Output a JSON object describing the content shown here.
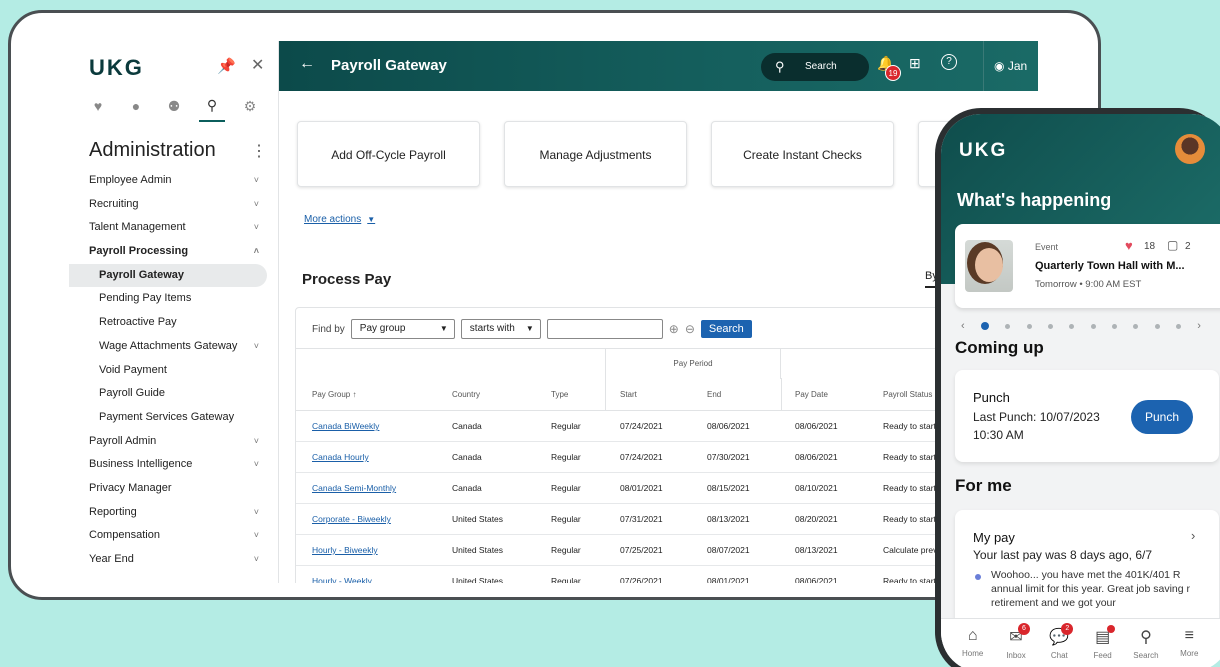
{
  "sidebar": {
    "logo": "UKG",
    "title": "Administration",
    "items": [
      {
        "label": "Employee Admin",
        "chevron": "˅"
      },
      {
        "label": "Recruiting",
        "chevron": "˅"
      },
      {
        "label": "Talent Management",
        "chevron": "˅"
      },
      {
        "label": "Payroll Processing",
        "chevron": "˄"
      },
      {
        "label": "Payroll Gateway"
      },
      {
        "label": "Pending Pay Items"
      },
      {
        "label": "Retroactive Pay"
      },
      {
        "label": "Wage Attachments Gateway",
        "chevron": "˅"
      },
      {
        "label": "Void Payment"
      },
      {
        "label": "Payroll Guide"
      },
      {
        "label": "Payment Services Gateway"
      },
      {
        "label": "Payroll Admin",
        "chevron": "˅"
      },
      {
        "label": "Business Intelligence",
        "chevron": "˅"
      },
      {
        "label": "Privacy Manager"
      },
      {
        "label": "Reporting",
        "chevron": "˅"
      },
      {
        "label": "Compensation",
        "chevron": "˅"
      },
      {
        "label": "Year End",
        "chevron": "˅"
      }
    ],
    "icons": [
      "heart-icon",
      "person-icon",
      "people-icon",
      "admin-icon",
      "gear-icon"
    ]
  },
  "topbar": {
    "title": "Payroll Gateway",
    "search_label": "Search",
    "notifications": "19",
    "user": "Jan"
  },
  "actions": [
    "Add Off-Cycle Payroll",
    "Manage Adjustments",
    "Create Instant Checks"
  ],
  "more_actions": "More actions",
  "process_pay": {
    "title": "Process Pay",
    "view_tab": "By",
    "find_by": "Find by",
    "field": "Pay group",
    "operator": "starts with",
    "search_button": "Search",
    "group_header": "Pay Period",
    "columns": [
      "Pay Group ↑",
      "Country",
      "Type",
      "Start",
      "End",
      "Pay Date",
      "Payroll Status"
    ],
    "rows": [
      [
        "Canada BiWeekly",
        "Canada",
        "Regular",
        "07/24/2021",
        "08/06/2021",
        "08/06/2021",
        "Ready to start"
      ],
      [
        "Canada Hourly",
        "Canada",
        "Regular",
        "07/24/2021",
        "07/30/2021",
        "08/06/2021",
        "Ready to start"
      ],
      [
        "Canada Semi-Monthly",
        "Canada",
        "Regular",
        "08/01/2021",
        "08/15/2021",
        "08/10/2021",
        "Ready to start"
      ],
      [
        "Corporate - Biweekly",
        "United States",
        "Regular",
        "07/31/2021",
        "08/13/2021",
        "08/20/2021",
        "Ready to start"
      ],
      [
        "Hourly - Biweekly",
        "United States",
        "Regular",
        "07/25/2021",
        "08/07/2021",
        "08/13/2021",
        "Calculate prev"
      ],
      [
        "Hourly - Weekly",
        "United States",
        "Regular",
        "07/26/2021",
        "08/01/2021",
        "08/06/2021",
        "Ready to start"
      ]
    ]
  },
  "phone": {
    "logo": "UKG",
    "heading": "What's happening",
    "event": {
      "type": "Event",
      "likes": "18",
      "comments": "2",
      "title": "Quarterly Town Hall with M...",
      "time": "Tomorrow • 9:00 AM EST"
    },
    "coming_up": "Coming up",
    "punch": {
      "title": "Punch",
      "last": "Last Punch: 10/07/2023",
      "time": "10:30 AM",
      "button": "Punch"
    },
    "for_me": "For me",
    "my_pay": {
      "title": "My pay",
      "last": "Your last pay was 8 days ago, 6/7",
      "body": "Woohoo... you have met the 401K/401 R annual limit for this year. Great job saving r retirement and we got your"
    },
    "tabs": [
      {
        "label": "Home",
        "badge": ""
      },
      {
        "label": "Inbox",
        "badge": "6"
      },
      {
        "label": "Chat",
        "badge": "2"
      },
      {
        "label": "Feed",
        "badge": ""
      },
      {
        "label": "Search",
        "badge": ""
      },
      {
        "label": "More",
        "badge": ""
      }
    ]
  },
  "colors": {
    "header_teal": "#0c4a4a",
    "link_blue": "#1a5fa8",
    "primary_button": "#1c63b0",
    "badge_red": "#d9262c",
    "background": "#b4ece4"
  }
}
